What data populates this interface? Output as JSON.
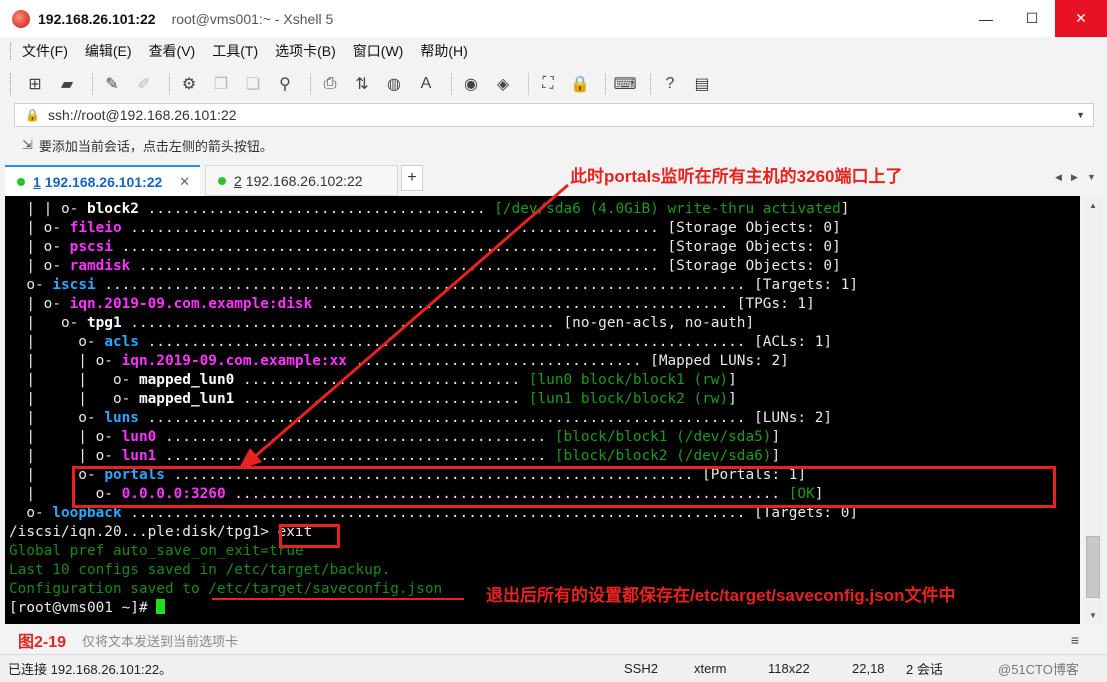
{
  "window": {
    "title_host": "192.168.26.101:22",
    "title_rest": "root@vms001:~ - Xshell 5",
    "min_label": "—",
    "max_label": "☐",
    "close_label": "✕"
  },
  "menu": [
    "文件(F)",
    "编辑(E)",
    "查看(V)",
    "工具(T)",
    "选项卡(B)",
    "窗口(W)",
    "帮助(H)"
  ],
  "address": {
    "value": "ssh://root@192.168.26.101:22",
    "lock_icon": "🔒",
    "dropdown": "▼"
  },
  "hint": {
    "text": "要添加当前会话，点击左侧的箭头按钮。"
  },
  "tabs": [
    {
      "num": "1",
      "label": "192.168.26.101:22",
      "active": true
    },
    {
      "num": "2",
      "label": "192.168.26.102:22",
      "active": false
    }
  ],
  "tab_close": "✕",
  "tab_add": "+",
  "tab_nav_left": "◀",
  "tab_nav_right": "▶",
  "tab_nav_menu": "▼",
  "terminal": {
    "lines": [
      {
        "segs": [
          [
            "w",
            "  | | o- "
          ],
          [
            "wb",
            "block2"
          ],
          [
            "w",
            " ....................................... "
          ],
          [
            "g",
            "[/dev/sda6 (4.0GiB) write-thru activated"
          ],
          [
            "w",
            "]"
          ]
        ]
      },
      {
        "segs": [
          [
            "w",
            "  | o- "
          ],
          [
            "m",
            "fileio"
          ],
          [
            "w",
            " ............................................................. "
          ],
          [
            "w",
            "[Storage Objects: 0]"
          ]
        ]
      },
      {
        "segs": [
          [
            "w",
            "  | o- "
          ],
          [
            "m",
            "pscsi"
          ],
          [
            "w",
            " .............................................................. "
          ],
          [
            "w",
            "[Storage Objects: 0]"
          ]
        ]
      },
      {
        "segs": [
          [
            "w",
            "  | o- "
          ],
          [
            "m",
            "ramdisk"
          ],
          [
            "w",
            " ............................................................ "
          ],
          [
            "w",
            "[Storage Objects: 0]"
          ]
        ]
      },
      {
        "segs": [
          [
            "w",
            "  o- "
          ],
          [
            "c",
            "iscsi"
          ],
          [
            "w",
            " .......................................................................... "
          ],
          [
            "w",
            "[Targets: 1]"
          ]
        ]
      },
      {
        "segs": [
          [
            "w",
            "  | o- "
          ],
          [
            "m",
            "iqn.2019-09.com.example:disk"
          ],
          [
            "w",
            " ............................................... "
          ],
          [
            "w",
            "[TPGs: 1]"
          ]
        ]
      },
      {
        "segs": [
          [
            "w",
            "  |   o- "
          ],
          [
            "wb",
            "tpg1"
          ],
          [
            "w",
            " ................................................. "
          ],
          [
            "w",
            "[no-gen-acls, no-auth]"
          ]
        ]
      },
      {
        "segs": [
          [
            "w",
            "  |     o- "
          ],
          [
            "c",
            "acls"
          ],
          [
            "w",
            " ..................................................................... "
          ],
          [
            "w",
            "[ACLs: 1]"
          ]
        ]
      },
      {
        "segs": [
          [
            "w",
            "  |     | o- "
          ],
          [
            "m",
            "iqn.2019-09.com.example:xx"
          ],
          [
            "w",
            " ................................. "
          ],
          [
            "w",
            "[Mapped LUNs: 2]"
          ]
        ]
      },
      {
        "segs": [
          [
            "w",
            "  |     |   o- "
          ],
          [
            "wb",
            "mapped_lun0"
          ],
          [
            "w",
            " ................................ "
          ],
          [
            "g",
            "[lun0 block/block1 (rw)"
          ],
          [
            "w",
            "]"
          ]
        ]
      },
      {
        "segs": [
          [
            "w",
            "  |     |   o- "
          ],
          [
            "wb",
            "mapped_lun1"
          ],
          [
            "w",
            " ................................ "
          ],
          [
            "g",
            "[lun1 block/block2 (rw)"
          ],
          [
            "w",
            "]"
          ]
        ]
      },
      {
        "segs": [
          [
            "w",
            "  |     o- "
          ],
          [
            "c",
            "luns"
          ],
          [
            "w",
            " ..................................................................... "
          ],
          [
            "w",
            "[LUNs: 2]"
          ]
        ]
      },
      {
        "segs": [
          [
            "w",
            "  |     | o- "
          ],
          [
            "m",
            "lun0"
          ],
          [
            "w",
            " ............................................ "
          ],
          [
            "g",
            "[block/block1 (/dev/sda5)"
          ],
          [
            "w",
            "]"
          ]
        ]
      },
      {
        "segs": [
          [
            "w",
            "  |     | o- "
          ],
          [
            "m",
            "lun1"
          ],
          [
            "w",
            " ............................................ "
          ],
          [
            "g",
            "[block/block2 (/dev/sda6)"
          ],
          [
            "w",
            "]"
          ]
        ]
      },
      {
        "segs": [
          [
            "w",
            "  |     o- "
          ],
          [
            "c",
            "portals"
          ],
          [
            "w",
            " ............................................................ "
          ],
          [
            "w",
            "[Portals: 1]"
          ]
        ]
      },
      {
        "segs": [
          [
            "w",
            "  |       o- "
          ],
          [
            "m",
            "0.0.0.0:3260"
          ],
          [
            "w",
            " ............................................................... "
          ],
          [
            "g",
            "[OK"
          ],
          [
            "w",
            "]"
          ]
        ]
      },
      {
        "segs": [
          [
            "w",
            "  o- "
          ],
          [
            "c",
            "loopback"
          ],
          [
            "w",
            " ....................................................................... "
          ],
          [
            "w",
            "[Targets: 0]"
          ]
        ]
      },
      {
        "segs": [
          [
            "w",
            "/iscsi/iqn.20...ple:disk/tpg1> exit"
          ]
        ]
      },
      {
        "segs": [
          [
            "dg",
            "Global pref auto_save_on_exit=true"
          ]
        ]
      },
      {
        "segs": [
          [
            "dg",
            "Last 10 configs saved in /etc/target/backup."
          ]
        ]
      },
      {
        "segs": [
          [
            "dg",
            "Configuration saved to /etc/target/saveconfig.json"
          ]
        ]
      },
      {
        "segs": [
          [
            "w",
            "[root@vms001 ~]# "
          ]
        ]
      }
    ]
  },
  "annotations": {
    "top": "此时portals监听在所有主机的3260端口上了",
    "bottom": "退出后所有的设置都保存在/etc/target/saveconfig.json文件中",
    "figure": "图2-19"
  },
  "compose": {
    "text": "仅将文本发送到当前选项卡",
    "menu_icon": "≡"
  },
  "status": {
    "connection": "已连接 192.168.26.101:22。",
    "protocol": "SSH2",
    "term": "xterm",
    "size": "118x22",
    "pos": "22,18",
    "sessions": "2 会话",
    "watermark": "@51CTO博客"
  },
  "colors": {
    "accent": "#1e90ff",
    "annotation_red": "#e8231f",
    "terminal_bg": "#000000",
    "magenta": "#ff33ff",
    "cyan": "#29a8ff",
    "green": "#1a9c1a"
  }
}
